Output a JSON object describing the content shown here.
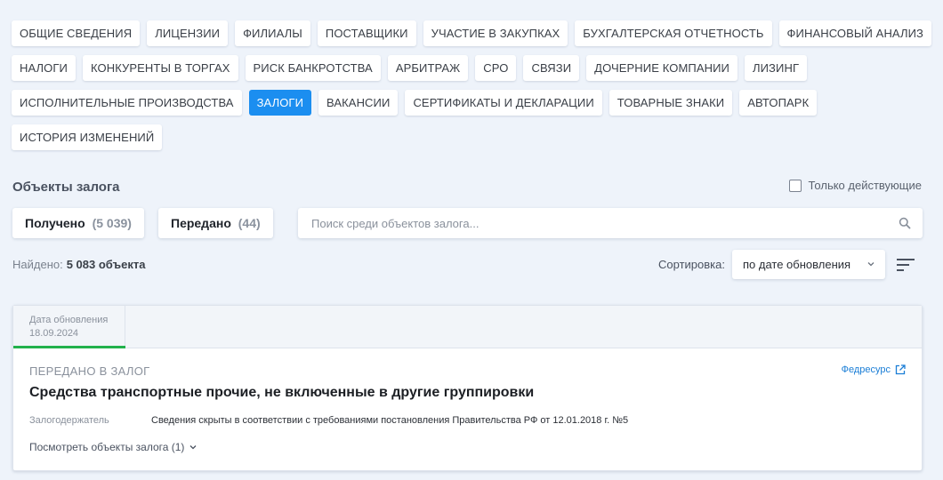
{
  "tabs": {
    "row1": [
      {
        "label": "ОБЩИЕ СВЕДЕНИЯ"
      },
      {
        "label": "ЛИЦЕНЗИИ"
      },
      {
        "label": "ФИЛИАЛЫ"
      },
      {
        "label": "ПОСТАВЩИКИ"
      },
      {
        "label": "УЧАСТИЕ В ЗАКУПКАХ"
      },
      {
        "label": "БУХГАЛТЕРСКАЯ ОТЧЕТНОСТЬ"
      },
      {
        "label": "ФИНАНСОВЫЙ АНАЛИЗ"
      }
    ],
    "row2": [
      {
        "label": "НАЛОГИ"
      },
      {
        "label": "КОНКУРЕНТЫ В ТОРГАХ"
      },
      {
        "label": "РИСК БАНКРОТСТВА"
      },
      {
        "label": "АРБИТРАЖ"
      },
      {
        "label": "СРО"
      },
      {
        "label": "СВЯЗИ"
      },
      {
        "label": "ДОЧЕРНИЕ КОМПАНИИ"
      },
      {
        "label": "ЛИЗИНГ"
      }
    ],
    "row3": [
      {
        "label": "ИСПОЛНИТЕЛЬНЫЕ ПРОИЗВОДСТВА"
      },
      {
        "label": "ЗАЛОГИ",
        "active": true
      },
      {
        "label": "ВАКАНСИИ"
      },
      {
        "label": "СЕРТИФИКАТЫ И ДЕКЛАРАЦИИ"
      },
      {
        "label": "ТОВАРНЫЕ ЗНАКИ"
      },
      {
        "label": "АВТОПАРК"
      }
    ],
    "row4": [
      {
        "label": "ИСТОРИЯ ИЗМЕНЕНИЙ"
      }
    ]
  },
  "section": {
    "title": "Объекты залога",
    "only_active_label": "Только действующие",
    "only_active_checked": false
  },
  "filters": {
    "received_label": "Получено",
    "received_count": "(5 039)",
    "transferred_label": "Передано",
    "transferred_count": "(44)"
  },
  "search": {
    "placeholder": "Поиск среди объектов залога...",
    "value": ""
  },
  "results": {
    "found_label": "Найдено:",
    "found_value": "5 083 объекта"
  },
  "sort": {
    "label": "Сортировка:",
    "selected": "по дате обновления"
  },
  "card": {
    "date_label": "Дата обновления",
    "date_value": "18.09.2024",
    "status": "ПЕРЕДАНО В ЗАЛОГ",
    "source_link": "Федресурс",
    "title": "Средства транспортные прочие, не включенные в другие группировки",
    "holder_label": "Залогодержатель",
    "holder_value": "Сведения скрыты в соответствии с требованиями постановления Правительства РФ от 12.01.2018 г. №5",
    "view_objects": "Посмотреть объекты залога (1)"
  },
  "colors": {
    "accent": "#1b8ef0",
    "background": "#eef3fa",
    "active_underline": "#22b14c",
    "link": "#1b7ed6"
  },
  "icons": [
    "search-icon",
    "sort-icon",
    "chevron-down-icon",
    "external-link-icon",
    "checkbox"
  ]
}
